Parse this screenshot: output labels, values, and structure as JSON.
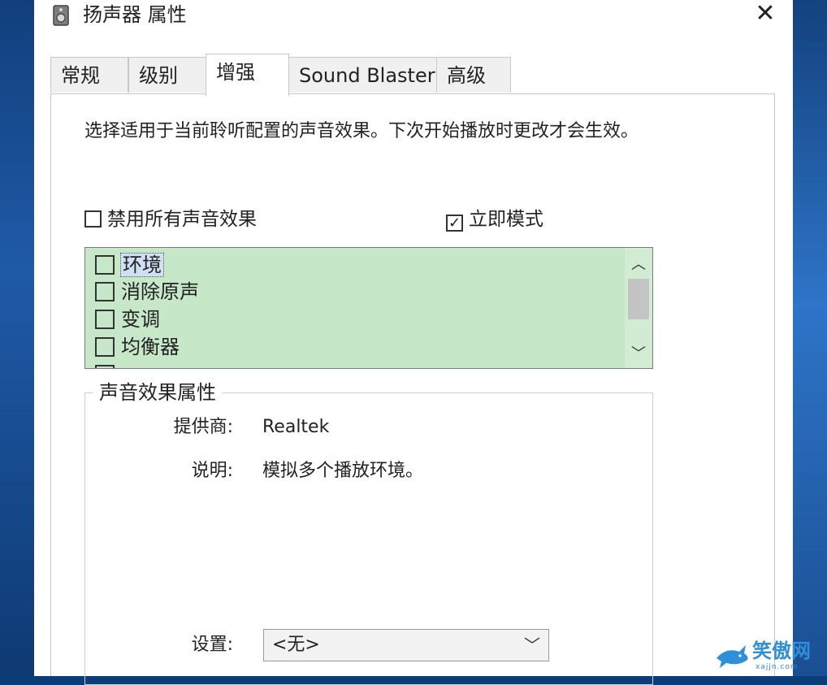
{
  "window": {
    "title": "扬声器 属性",
    "close_label": "✕"
  },
  "tabs": [
    {
      "label": "常规"
    },
    {
      "label": "级别"
    },
    {
      "label": "增强",
      "active": true
    },
    {
      "label": "Sound Blaster"
    },
    {
      "label": "高级"
    }
  ],
  "description": "选择适用于当前聆听配置的声音效果。下次开始播放时更改才会生效。",
  "options": {
    "disable_all": {
      "label": "禁用所有声音效果",
      "checked": false
    },
    "immediate_mode": {
      "label": "立即模式",
      "checked": true
    }
  },
  "effects": [
    {
      "label": "环境",
      "checked": false,
      "selected": true
    },
    {
      "label": "消除原声",
      "checked": false
    },
    {
      "label": "变调",
      "checked": false
    },
    {
      "label": "均衡器",
      "checked": false
    }
  ],
  "effect_properties": {
    "group_title": "声音效果属性",
    "provider_label": "提供商:",
    "provider_value": "Realtek",
    "description_label": "说明:",
    "description_value": "模拟多个播放环境。",
    "settings_label": "设置:",
    "settings_value": "<无>"
  },
  "watermark": {
    "text": "笑傲网",
    "subtext": "xajjn.com"
  },
  "colors": {
    "list_background": "#c6e8c9",
    "selection": "#cfe0f5",
    "desktop": "#0b3d78"
  }
}
